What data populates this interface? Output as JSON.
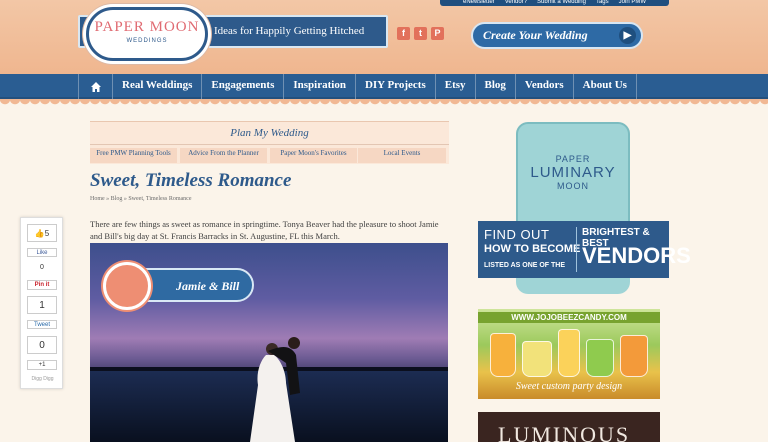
{
  "header": {
    "top_links": [
      "eNewsletter",
      "Vendor?",
      "Submit a Wedding",
      "Tags",
      "Join PMW"
    ],
    "logo_title": "PAPER MOON",
    "logo_subtitle": "WEDDINGS",
    "tagline": "Ideas for Happily Getting Hitched",
    "social": [
      {
        "icon": "facebook-icon",
        "glyph": "f"
      },
      {
        "icon": "twitter-icon",
        "glyph": "t"
      },
      {
        "icon": "pinterest-icon",
        "glyph": "P"
      }
    ],
    "create_button": "Create Your Wedding",
    "create_arrow": "▶"
  },
  "nav": {
    "home_icon": "home-icon",
    "items": [
      "Real Weddings",
      "Engagements",
      "Inspiration",
      "DIY Projects",
      "Etsy",
      "Blog",
      "Vendors",
      "About Us"
    ]
  },
  "plan": {
    "title": "Plan My Wedding",
    "tabs": [
      "Free PMW Planning Tools",
      "Advice From the Planner",
      "Paper Moon's Favorites",
      "Local Events"
    ]
  },
  "article": {
    "title": "Sweet, Timeless Romance",
    "breadcrumbs": "Home » Blog » Sweet, Timeless Romance",
    "intro": "There are few things as sweet as romance in springtime. Tonya Beaver had the pleasure to shoot Jamie and Bill's big day at St. Francis Barracks in St. Augustine, FL this March.",
    "photo_badge": "Jamie & Bill"
  },
  "share": {
    "like_count": "5",
    "fb_label": "Like",
    "fb_count": "0",
    "pin_label": "Pin it",
    "tweet_count": "1",
    "tweet_label": "Tweet",
    "gplus_count": "0",
    "gplus_label": "+1",
    "digg_label": "Digg Digg"
  },
  "sidebar": {
    "luminary": {
      "paper": "PAPER",
      "main": "LUMINARY",
      "moon": "MOON",
      "line1": "FIND OUT",
      "line2": "HOW TO BECOME",
      "line3": "LISTED AS ONE OF THE",
      "right1": "BRIGHTEST & BEST",
      "right2": "VENDORS"
    },
    "candy": {
      "url": "WWW.JOJOBEEZCANDY.COM",
      "tagline": "Sweet custom party design"
    },
    "luminous": "LUMINOUS"
  },
  "colors": {
    "header_peach": "#efb68f",
    "navy": "#2e5a8b",
    "nav_blue": "#2a5d92",
    "coral": "#e06b72",
    "background": "#fbf4ea"
  }
}
